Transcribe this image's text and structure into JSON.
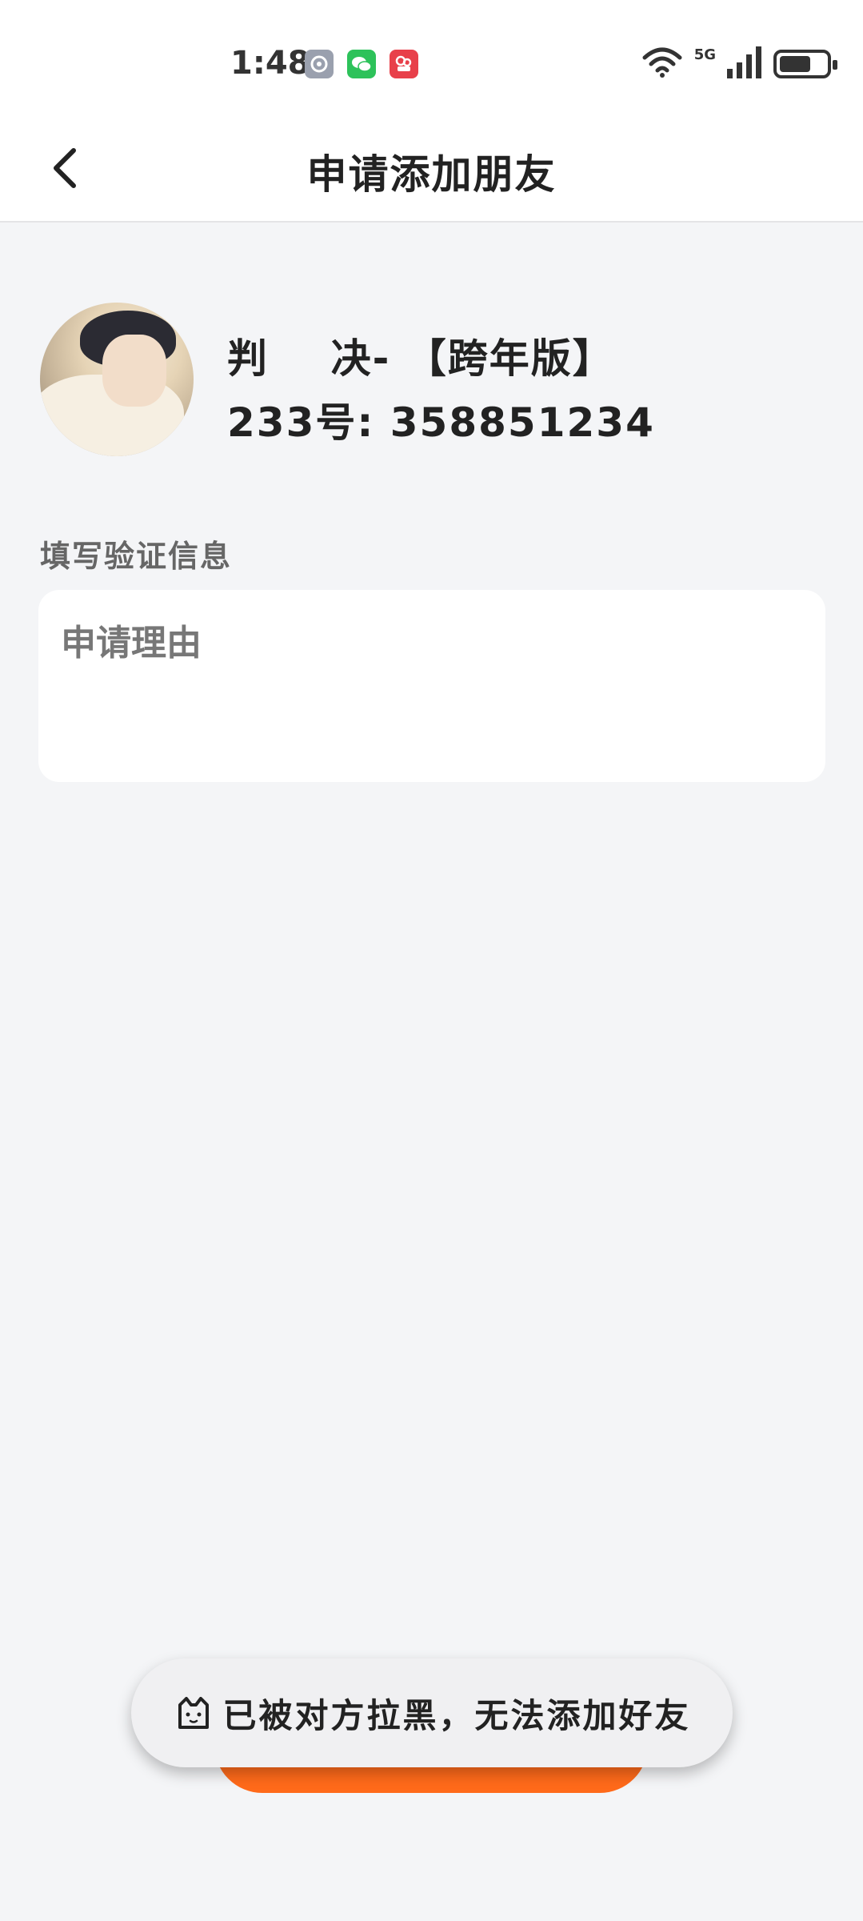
{
  "status_bar": {
    "time": "1:48",
    "network": "5G",
    "notification_icons": [
      "settings-icon",
      "wechat-icon",
      "red-app-icon"
    ]
  },
  "nav": {
    "title": "申请添加朋友",
    "back_icon": "chevron-left-icon"
  },
  "profile": {
    "name": "判    决- 【跨年版】",
    "id_text": "233号: 358851234"
  },
  "form": {
    "section_label": "填写验证信息",
    "reason_placeholder": "申请理由",
    "reason_value": ""
  },
  "toast": {
    "icon": "cat-face-icon",
    "message": "已被对方拉黑，无法添加好友"
  },
  "colors": {
    "accent": "#ff6a1a",
    "background": "#f4f5f7"
  }
}
